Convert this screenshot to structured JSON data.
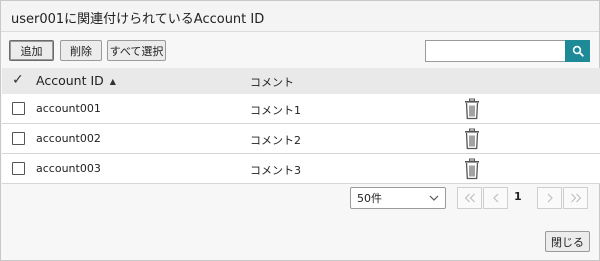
{
  "dialog": {
    "title": "user001に関連付けられているAccount ID"
  },
  "toolbar": {
    "add_label": "追加",
    "delete_label": "削除",
    "select_all_label": "すべて選択"
  },
  "search": {
    "placeholder": "",
    "value": ""
  },
  "table": {
    "columns": {
      "account": "Account ID",
      "comment": "コメント"
    },
    "rows": [
      {
        "account": "account001",
        "comment": "コメント1"
      },
      {
        "account": "account002",
        "comment": "コメント2"
      },
      {
        "account": "account003",
        "comment": "コメント3"
      }
    ]
  },
  "pagination": {
    "page_size": "50件",
    "current_page": "1"
  },
  "footer": {
    "close_label": "閉じる"
  },
  "colors": {
    "accent": "#1e8a98",
    "header_bg": "#e9e9e9"
  },
  "icons": [
    "check-icon",
    "sort-ascending-icon",
    "search-icon",
    "trash-icon",
    "chevron-down-icon",
    "first-page-icon",
    "previous-page-icon",
    "next-page-icon",
    "last-page-icon"
  ]
}
